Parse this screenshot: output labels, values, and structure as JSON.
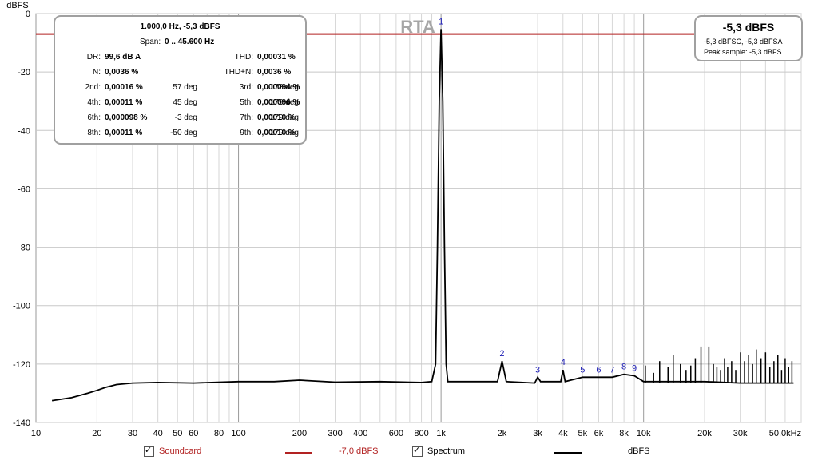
{
  "chart_data": {
    "type": "line",
    "title": "RTA",
    "ylabel": "dBFS",
    "xunit": "Hz",
    "xlim": [
      10,
      60000
    ],
    "ylim": [
      -140,
      0
    ],
    "xscale": "log",
    "yticks": [
      0,
      -20,
      -40,
      -60,
      -80,
      -100,
      -120,
      -140
    ],
    "xticks": [
      {
        "v": 10,
        "t": "10"
      },
      {
        "v": 20,
        "t": "20"
      },
      {
        "v": 30,
        "t": "30"
      },
      {
        "v": 40,
        "t": "40"
      },
      {
        "v": 50,
        "t": "50"
      },
      {
        "v": 60,
        "t": "60"
      },
      {
        "v": 80,
        "t": "80"
      },
      {
        "v": 100,
        "t": "100"
      },
      {
        "v": 200,
        "t": "200"
      },
      {
        "v": 300,
        "t": "300"
      },
      {
        "v": 400,
        "t": "400"
      },
      {
        "v": 600,
        "t": "600"
      },
      {
        "v": 800,
        "t": "800"
      },
      {
        "v": 1000,
        "t": "1k"
      },
      {
        "v": 2000,
        "t": "2k"
      },
      {
        "v": 3000,
        "t": "3k"
      },
      {
        "v": 4000,
        "t": "4k"
      },
      {
        "v": 5000,
        "t": "5k"
      },
      {
        "v": 6000,
        "t": "6k"
      },
      {
        "v": 8000,
        "t": "8k"
      },
      {
        "v": 10000,
        "t": "10k"
      },
      {
        "v": 20000,
        "t": "20k"
      },
      {
        "v": 30000,
        "t": "30k"
      },
      {
        "v": 50000,
        "t": "50,0kHz"
      }
    ],
    "grid": true,
    "reference_line": {
      "name": "Soundcard",
      "value": -7.0,
      "label": "-7,0 dBFS",
      "color": "#b22222"
    },
    "series": [
      {
        "name": "Spectrum",
        "unit": "dBFS",
        "color": "#000000",
        "points": [
          [
            12,
            -132.5
          ],
          [
            15,
            -131.5
          ],
          [
            18,
            -130
          ],
          [
            20,
            -129
          ],
          [
            22,
            -128
          ],
          [
            25,
            -127
          ],
          [
            30,
            -126.5
          ],
          [
            40,
            -126.3
          ],
          [
            60,
            -126.5
          ],
          [
            100,
            -126
          ],
          [
            150,
            -126
          ],
          [
            200,
            -125.5
          ],
          [
            300,
            -126.2
          ],
          [
            500,
            -126
          ],
          [
            800,
            -126.3
          ],
          [
            900,
            -126
          ],
          [
            940,
            -120
          ],
          [
            960,
            -80
          ],
          [
            980,
            -30
          ],
          [
            1000,
            -5.3
          ],
          [
            1020,
            -30
          ],
          [
            1040,
            -80
          ],
          [
            1060,
            -120
          ],
          [
            1080,
            -126
          ],
          [
            1500,
            -126
          ],
          [
            1900,
            -126
          ],
          [
            2000,
            -119
          ],
          [
            2100,
            -126
          ],
          [
            2900,
            -126.5
          ],
          [
            3000,
            -124.5
          ],
          [
            3100,
            -126
          ],
          [
            3900,
            -126
          ],
          [
            4000,
            -122
          ],
          [
            4100,
            -126
          ],
          [
            5000,
            -124.5
          ],
          [
            6000,
            -124.5
          ],
          [
            7000,
            -124.5
          ],
          [
            8000,
            -123.5
          ],
          [
            9000,
            -124
          ],
          [
            10000,
            -126
          ],
          [
            20000,
            -126
          ],
          [
            30000,
            -126.5
          ],
          [
            55000,
            -126.5
          ]
        ]
      }
    ],
    "harmonic_labels": [
      {
        "n": "1",
        "f": 1000,
        "y": -5.3
      },
      {
        "n": "2",
        "f": 2000,
        "y": -119
      },
      {
        "n": "3",
        "f": 3000,
        "y": -124.5
      },
      {
        "n": "4",
        "f": 4000,
        "y": -122
      },
      {
        "n": "5",
        "f": 5000,
        "y": -124.5
      },
      {
        "n": "6",
        "f": 6000,
        "y": -124.5
      },
      {
        "n": "7",
        "f": 7000,
        "y": -124.5
      },
      {
        "n": "8",
        "f": 8000,
        "y": -123.5
      },
      {
        "n": "9",
        "f": 9000,
        "y": -124
      }
    ],
    "spurs": [
      {
        "f": 10200,
        "y": -120.5
      },
      {
        "f": 11200,
        "y": -123
      },
      {
        "f": 12000,
        "y": -119
      },
      {
        "f": 13200,
        "y": -121
      },
      {
        "f": 14000,
        "y": -117
      },
      {
        "f": 15200,
        "y": -120
      },
      {
        "f": 16200,
        "y": -122
      },
      {
        "f": 17100,
        "y": -120.5
      },
      {
        "f": 18000,
        "y": -118
      },
      {
        "f": 19200,
        "y": -114
      },
      {
        "f": 21000,
        "y": -114
      },
      {
        "f": 22100,
        "y": -120
      },
      {
        "f": 23000,
        "y": -121
      },
      {
        "f": 24000,
        "y": -122
      },
      {
        "f": 25100,
        "y": -118
      },
      {
        "f": 26000,
        "y": -121
      },
      {
        "f": 27200,
        "y": -119
      },
      {
        "f": 28500,
        "y": -122
      },
      {
        "f": 30100,
        "y": -116
      },
      {
        "f": 31500,
        "y": -119
      },
      {
        "f": 33000,
        "y": -117
      },
      {
        "f": 34500,
        "y": -120
      },
      {
        "f": 36000,
        "y": -115
      },
      {
        "f": 38000,
        "y": -118
      },
      {
        "f": 40000,
        "y": -116
      },
      {
        "f": 42000,
        "y": -121
      },
      {
        "f": 44000,
        "y": -119
      },
      {
        "f": 46000,
        "y": -117
      },
      {
        "f": 48000,
        "y": -122
      },
      {
        "f": 50000,
        "y": -118
      },
      {
        "f": 52000,
        "y": -121
      },
      {
        "f": 54000,
        "y": -119
      }
    ]
  },
  "info_panel": {
    "header1": "1.000,0 Hz, -5,3 dBFS",
    "span_label": "Span:",
    "span_value": "0 .. 45.600 Hz",
    "rows": [
      {
        "l1": "DR:",
        "v1": "99,6 dB A",
        "p1": "",
        "l2": "THD:",
        "v2": "0,00031 %",
        "p2": ""
      },
      {
        "l1": "N:",
        "v1": "0,0036 %",
        "p1": "",
        "l2": "THD+N:",
        "v2": "0,0036 %",
        "p2": ""
      },
      {
        "l1": "2nd:",
        "v1": "0,00016 %",
        "p1": "57 deg",
        "l2": "3rd:",
        "v2": "0,000094 %",
        "p2": "-178 deg"
      },
      {
        "l1": "4th:",
        "v1": "0,00011 %",
        "p1": "45 deg",
        "l2": "5th:",
        "v2": "0,000096 %",
        "p2": "-179 deg"
      },
      {
        "l1": "6th:",
        "v1": "0,000098 %",
        "p1": "-3 deg",
        "l2": "7th:",
        "v2": "0,00010 %",
        "p2": "179 deg"
      },
      {
        "l1": "8th:",
        "v1": "0,00011 %",
        "p1": "-50 deg",
        "l2": "9th:",
        "v2": "0,00010 %",
        "p2": "-179 deg"
      }
    ]
  },
  "level_panel": {
    "main": "-5,3 dBFS",
    "sub": "-5,3 dBFSC, -5,3 dBFSA",
    "peak": "Peak sample: -5,3 dBFS"
  },
  "legend": {
    "soundcard_label": "Soundcard",
    "soundcard_value": "-7,0 dBFS",
    "spectrum_label": "Spectrum",
    "spectrum_value": "dBFS",
    "check": "✓"
  }
}
